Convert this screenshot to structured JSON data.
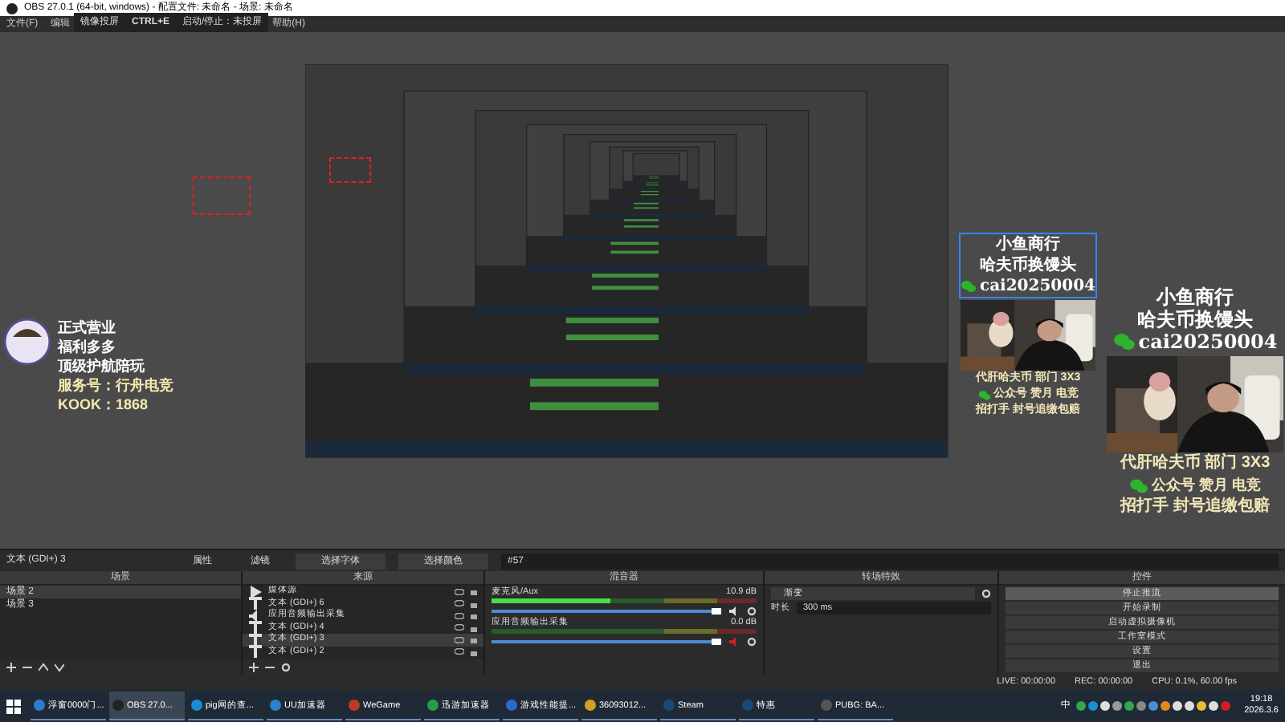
{
  "window": {
    "title": "OBS 27.0.1 (64-bit, windows) - 配置文件: 未命名 - 场景: 未命名"
  },
  "menu": [
    {
      "label": "文件(F)"
    },
    {
      "label": "编辑"
    },
    {
      "label": "帮助(H)"
    }
  ],
  "tooltip": {
    "name": "镜像投屏",
    "key": "CTRL+E",
    "action": "启动/停止：未投屏"
  },
  "canvas": {
    "logo": {
      "lines": [
        "正式营业",
        "福利多多",
        "顶级护航陪玩",
        "服务号：行舟电竞",
        "KOOK：1868"
      ]
    },
    "overlays": [
      {
        "lines": [
          "小鱼商行",
          "哈夫币换馒头"
        ],
        "wechat": "cai20250004",
        "bottom": [
          "代肝哈夫币 部门 3X3"
        ],
        "account": "公众号 赞月 电竞",
        "footer": "招打手 封号追缴包赔",
        "selected": true
      },
      {
        "lines": [
          "小鱼商行",
          "哈夫币换馒头"
        ],
        "wechat": "cai20250004",
        "bottom": [
          "代肝哈夫币 部门 3X3"
        ],
        "account": "公众号 赞月 电竞",
        "footer": "招打手 封号追缴包赔",
        "selected": false
      }
    ]
  },
  "properties_bar": {
    "source": "文本 (GDI+) 3",
    "buttons": [
      "属性",
      "滤镜",
      "选择字体",
      "选择颜色"
    ],
    "value": "#57"
  },
  "scenes": {
    "title": "场景",
    "items": [
      {
        "label": "场景 2",
        "selected": true
      },
      {
        "label": "场景 3",
        "selected": false
      }
    ]
  },
  "sources": {
    "title": "来源",
    "items": [
      {
        "kind": "media",
        "label": "媒体源",
        "selected": false
      },
      {
        "kind": "text",
        "label": "文本 (GDI+) 6",
        "selected": false
      },
      {
        "kind": "audio",
        "label": "应用音频输出采集",
        "selected": false
      },
      {
        "kind": "text",
        "label": "文本 (GDI+) 4",
        "selected": false
      },
      {
        "kind": "text",
        "label": "文本 (GDI+) 3",
        "selected": true
      },
      {
        "kind": "text",
        "label": "文本 (GDI+) 2",
        "selected": false
      }
    ]
  },
  "mixer": {
    "title": "混音器",
    "channels": [
      {
        "name": "麦克风/Aux",
        "reading": "10.9 dB",
        "level": 0.45,
        "volume": {
          "level": 0.95
        },
        "muted": false
      },
      {
        "name": "应用音频输出采集",
        "reading": "0.0 dB",
        "volume": {
          "level": 0.95
        },
        "muted": true
      }
    ]
  },
  "transitions": {
    "title": "转场特效",
    "transition": "渐变",
    "duration_label": "时长",
    "duration": "300 ms"
  },
  "controls": {
    "title": "控件",
    "buttons": [
      {
        "label": "停止推流",
        "selected": true
      },
      {
        "label": "开始录制",
        "selected": false
      },
      {
        "label": "启动虚拟摄像机",
        "selected": false
      },
      {
        "label": "工作室模式",
        "selected": false
      },
      {
        "label": "设置",
        "selected": false
      },
      {
        "label": "退出",
        "selected": false
      }
    ]
  },
  "status_bar": {
    "live": "LIVE: 00:00:00",
    "rec": "REC: 00:00:00",
    "cpu": "CPU: 0.1%, 60.00 fps"
  },
  "taskbar": {
    "apps": [
      {
        "label": "浮窗0000门...",
        "selected": false
      },
      {
        "label": "OBS 27.0...",
        "selected": true
      },
      {
        "label": "pig网的查...",
        "selected": false
      },
      {
        "label": "UU加速器",
        "selected": false
      },
      {
        "label": "WeGame",
        "selected": false
      },
      {
        "label": "迅游加速器",
        "selected": false
      },
      {
        "label": "游戏性能提...",
        "selected": false
      },
      {
        "label": "36093012...",
        "selected": false
      },
      {
        "label": "Steam",
        "selected": false
      },
      {
        "label": "特惠",
        "selected": false
      },
      {
        "label": "PUBG: BA...",
        "selected": false
      }
    ],
    "ime": "中",
    "time": "19:18",
    "date": "2026.3.6"
  }
}
